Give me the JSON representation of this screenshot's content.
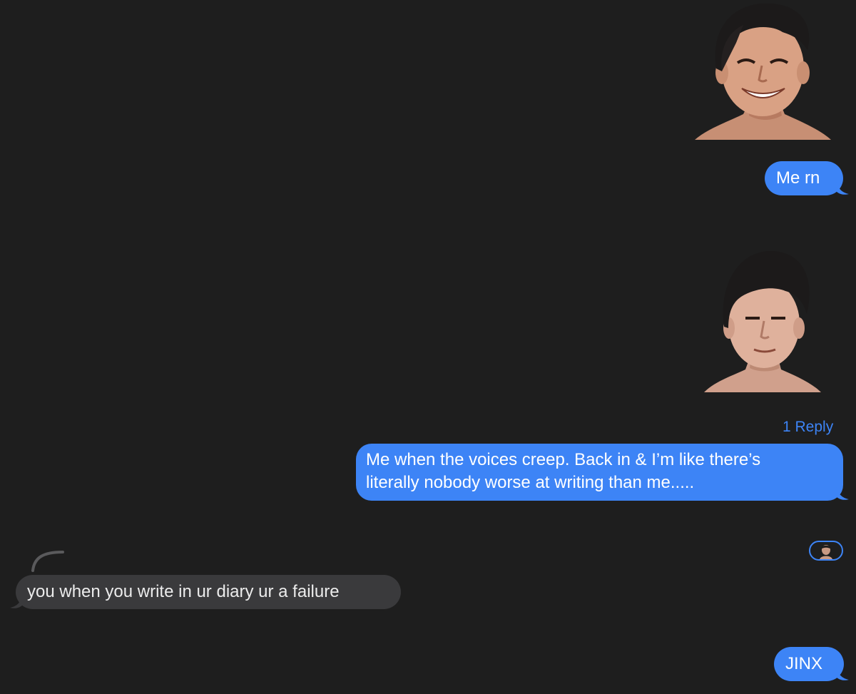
{
  "messages": [
    {
      "id": "m1",
      "type": "sticker",
      "side": "sent",
      "subject": "smiling-face-sticker"
    },
    {
      "id": "m2",
      "type": "text",
      "side": "sent",
      "text": "Me rn"
    },
    {
      "id": "m3",
      "type": "sticker",
      "side": "sent",
      "subject": "neutral-face-sticker"
    },
    {
      "id": "m4",
      "type": "text",
      "side": "sent",
      "reply_count": "1 Reply",
      "lines": [
        "Me when the voices creep. Back in & I’m like there’s",
        "literally nobody worse at writing than me....."
      ]
    },
    {
      "id": "m5",
      "type": "text",
      "side": "received",
      "text": "you when you write in ur diary ur a failure"
    },
    {
      "id": "m6",
      "type": "text",
      "side": "sent",
      "text": "JINX"
    }
  ],
  "colors": {
    "background": "#1e1e1e",
    "sent_bubble": "#3d84f6",
    "received_bubble": "#3a3a3c",
    "accent": "#3d84f6"
  },
  "icons": {
    "reply_avatar": "avatar-icon",
    "thread": "thread-curve-icon"
  }
}
